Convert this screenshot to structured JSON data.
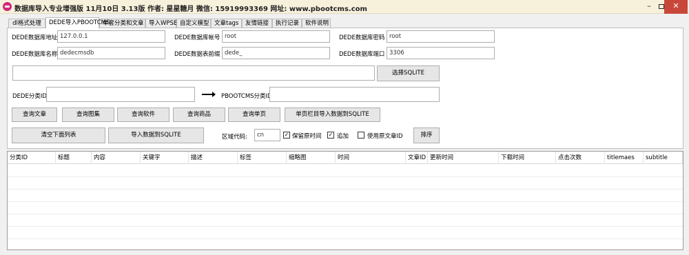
{
  "window": {
    "title": "数据库导入专业增强版 11月10日 3.13版 作者: 星星糖月 微信: 15919993369 网址: www.pbootcms.com",
    "minimize": "–",
    "close": "✕"
  },
  "tabs": [
    "dl格式处理",
    "DEDE导入PBOOTCMS",
    "单套分类和文章",
    "导入WPSEL",
    "自定义模型",
    "文章tags",
    "友情链接",
    "执行记录",
    "软件说明"
  ],
  "form": {
    "dede_host_label": "DEDE数据库地址",
    "dede_host_value": "127.0.0.1",
    "dede_user_label": "DEDE数据库帐号",
    "dede_user_value": "root",
    "dede_pass_label": "DEDE数据库密码",
    "dede_pass_value": "root",
    "dede_db_label": "DEDE数据库名称",
    "dede_db_value": "dedecmsdb",
    "dede_prefix_label": "DEDE数据表前缀",
    "dede_prefix_value": "dede_",
    "dede_port_label": "DEDE数据库端口",
    "dede_port_value": "3306",
    "sqlite_path_value": "",
    "select_sqlite_label": "选择SQLITE",
    "dede_cat_label": "DEDE分类ID:",
    "dede_cat_value": "",
    "pboot_cat_label": "PBOOTCMS分类ID:",
    "pboot_cat_value": ""
  },
  "buttons": {
    "query_article": "查询文章",
    "query_album": "查询图集",
    "query_software": "查询软件",
    "query_product": "查询商品",
    "query_single": "查询单页",
    "single_import": "单页栏目导入数据到SQLITE",
    "clear_list": "清空下面列表",
    "import_sqlite": "导入数据到SQLITE",
    "sort": "排序"
  },
  "options": {
    "lang_label": "区域代码:",
    "lang_value": "cn",
    "keep_time_label": "保留原时间",
    "keep_time_checked": true,
    "append_label": "追加",
    "append_checked": true,
    "use_original_id_label": "使用原文章ID",
    "use_original_id_checked": false
  },
  "table": {
    "columns": [
      "分类ID",
      "标题",
      "内容",
      "关键字",
      "描述",
      "标签",
      "缩略图",
      "时间",
      "文章ID",
      "更新时间",
      "下载时间",
      "点击次数",
      "titlemaes",
      "subtitle"
    ]
  }
}
